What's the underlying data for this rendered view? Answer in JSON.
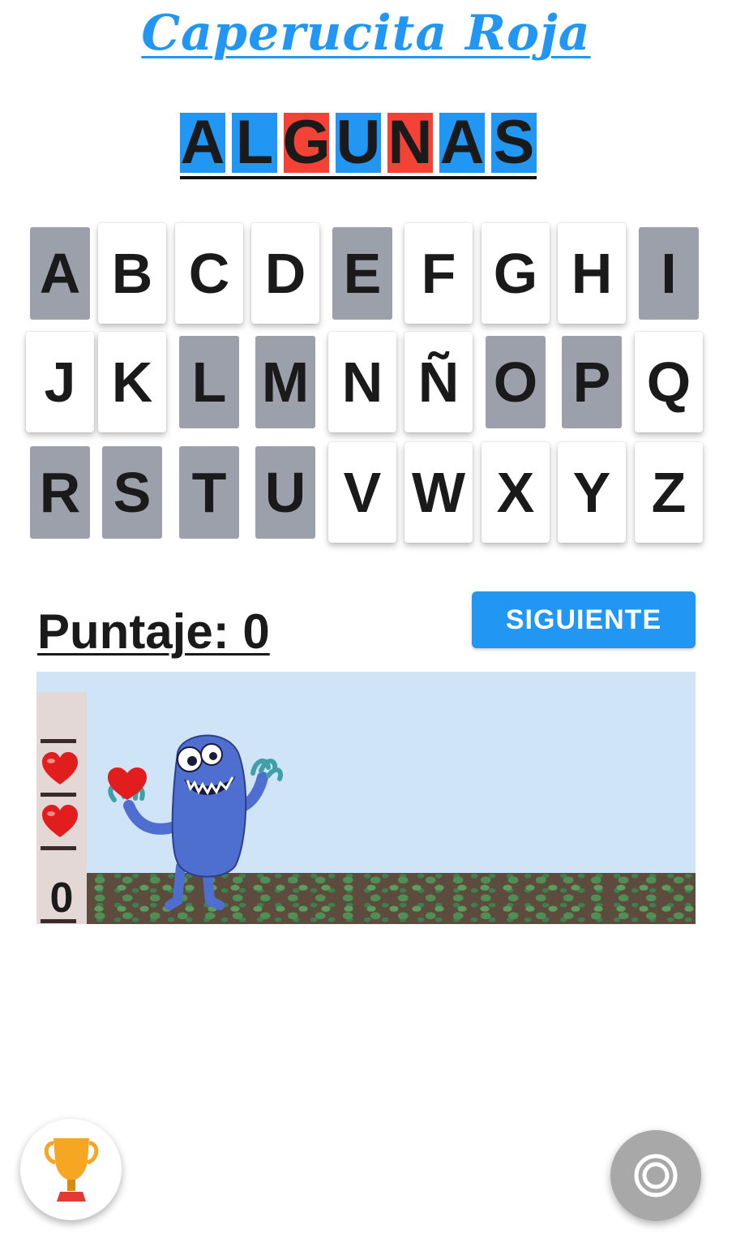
{
  "app": {
    "title": "Caperucita Roja"
  },
  "word": {
    "tiles": [
      {
        "letter": "A",
        "state": "blue"
      },
      {
        "letter": "L",
        "state": "blue"
      },
      {
        "letter": "G",
        "state": "red"
      },
      {
        "letter": "U",
        "state": "blue"
      },
      {
        "letter": "N",
        "state": "red"
      },
      {
        "letter": "A",
        "state": "blue"
      },
      {
        "letter": "S",
        "state": "blue"
      }
    ],
    "colors": {
      "blue": "#2196f3",
      "red": "#f44336"
    }
  },
  "keyboard": {
    "rows": [
      [
        {
          "letter": "A",
          "used": true
        },
        {
          "letter": "B",
          "used": false
        },
        {
          "letter": "C",
          "used": false
        },
        {
          "letter": "D",
          "used": false
        },
        {
          "letter": "E",
          "used": true
        },
        {
          "letter": "F",
          "used": false
        },
        {
          "letter": "G",
          "used": false
        },
        {
          "letter": "H",
          "used": false
        },
        {
          "letter": "I",
          "used": true
        }
      ],
      [
        {
          "letter": "J",
          "used": false
        },
        {
          "letter": "K",
          "used": false
        },
        {
          "letter": "L",
          "used": true
        },
        {
          "letter": "M",
          "used": true
        },
        {
          "letter": "N",
          "used": false
        },
        {
          "letter": "Ñ",
          "used": false
        },
        {
          "letter": "O",
          "used": true
        },
        {
          "letter": "P",
          "used": true
        },
        {
          "letter": "Q",
          "used": false
        }
      ],
      [
        {
          "letter": "R",
          "used": true
        },
        {
          "letter": "S",
          "used": true
        },
        {
          "letter": "T",
          "used": true
        },
        {
          "letter": "U",
          "used": true
        },
        {
          "letter": "V",
          "used": false
        },
        {
          "letter": "W",
          "used": false
        },
        {
          "letter": "X",
          "used": false
        },
        {
          "letter": "Y",
          "used": false
        },
        {
          "letter": "Z",
          "used": false
        }
      ]
    ]
  },
  "score": {
    "label": "Puntaje: 0"
  },
  "next_button": {
    "label": "SIGUIENTE"
  },
  "game": {
    "lives": 2,
    "lives_counter": "0",
    "colors": {
      "sky": "#cfe4f6",
      "monster": "#4f6fd0",
      "heart": "#e11d1d"
    }
  },
  "fabs": {
    "trophy_icon": "trophy-icon",
    "record_icon": "record-icon"
  }
}
